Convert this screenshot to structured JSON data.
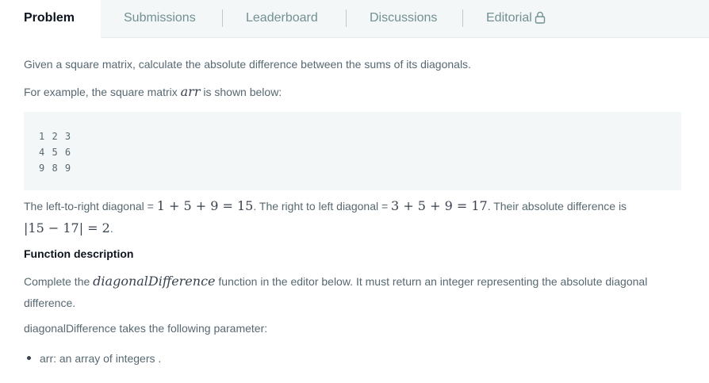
{
  "tabs": [
    {
      "label": "Problem",
      "active": true
    },
    {
      "label": "Submissions",
      "active": false
    },
    {
      "label": "Leaderboard",
      "active": false
    },
    {
      "label": "Discussions",
      "active": false
    },
    {
      "label": "Editorial",
      "active": false,
      "icon": "lock-icon"
    }
  ],
  "problem": {
    "intro": "Given a square matrix, calculate the absolute difference between the sums of its diagonals.",
    "example_prefix": "For example, the square matrix ",
    "example_var": "arr",
    "example_suffix": " is shown below:",
    "matrix_rows": [
      "1 2 3",
      "4 5 6",
      "9 8 9"
    ],
    "diag_text_1": "The left-to-right diagonal = ",
    "diag_math_1": "1 + 5 + 9 = 15",
    "diag_text_2": ". The right to left diagonal = ",
    "diag_math_2": "3 + 5 + 9 = 17",
    "diag_text_3": ". Their absolute difference is",
    "abs_math": "|15 − 17| = 2",
    "abs_suffix": ".",
    "function_heading": "Function description",
    "complete_prefix": "Complete the ",
    "function_name": "diagonalDifference",
    "complete_suffix": " function in the editor below. It must return an integer representing the absolute diagonal",
    "complete_line2": "difference.",
    "param_intro": "diagonalDifference takes the following parameter:",
    "param_item": "arr: an array of integers ."
  },
  "colors": {
    "tabbar_bg": "#f3f7f7",
    "code_bg": "#f3f7f7",
    "active_tab_text": "#0e141e",
    "inactive_tab_text": "#738f93"
  }
}
